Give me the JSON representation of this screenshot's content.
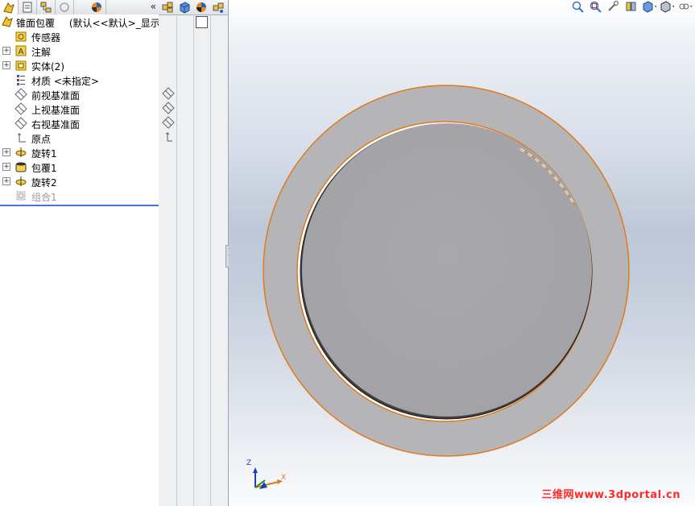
{
  "feature_tree": {
    "root_label": "锥面包覆",
    "root_config": "(默认<<默认>_显示状",
    "items": [
      {
        "label": "传感器",
        "icon": "sensor-folder-icon",
        "expandable": false
      },
      {
        "label": "注解",
        "icon": "annotations-icon",
        "expandable": true
      },
      {
        "label": "实体(2)",
        "icon": "solid-bodies-icon",
        "expandable": true
      },
      {
        "label": "材质 <未指定>",
        "icon": "material-icon",
        "expandable": false
      },
      {
        "label": "前视基准面",
        "icon": "plane-icon",
        "expandable": false
      },
      {
        "label": "上视基准面",
        "icon": "plane-icon",
        "expandable": false
      },
      {
        "label": "右视基准面",
        "icon": "plane-icon",
        "expandable": false
      },
      {
        "label": "原点",
        "icon": "origin-icon",
        "expandable": false
      },
      {
        "label": "旋转1",
        "icon": "revolve-icon",
        "expandable": true
      },
      {
        "label": "包覆1",
        "icon": "wrap-icon",
        "expandable": true
      },
      {
        "label": "旋转2",
        "icon": "revolve-icon",
        "expandable": true
      },
      {
        "label": "组合1",
        "icon": "combine-icon",
        "expandable": false,
        "suppressed": true
      }
    ],
    "collapse_glyph": "«"
  },
  "axes_triad": {
    "z": "Z",
    "x": "X"
  },
  "watermark": "三维网www.3dportal.cn",
  "colors": {
    "edge_highlight": "#e07a1a",
    "part_face": "#a8a8ac",
    "ring_face": "#b5b5b8",
    "rollback_bar": "#3b7ad9"
  }
}
